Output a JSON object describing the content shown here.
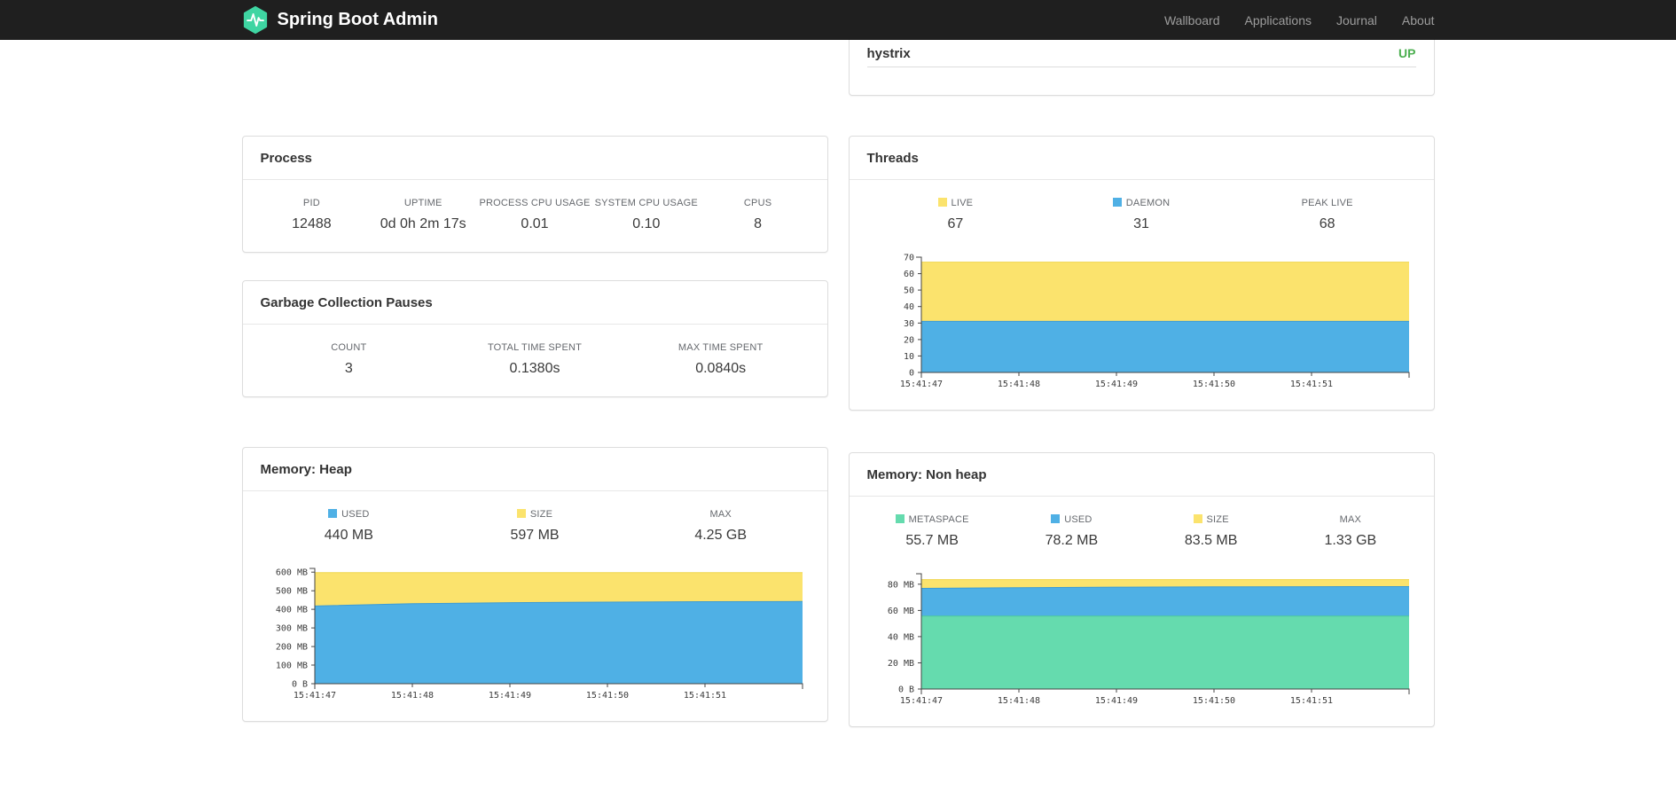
{
  "navbar": {
    "brand": "Spring Boot Admin",
    "links": [
      {
        "label": "Wallboard"
      },
      {
        "label": "Applications"
      },
      {
        "label": "Journal"
      },
      {
        "label": "About"
      }
    ]
  },
  "colors": {
    "brand_green": "#3FD5A2",
    "status_up": "#4CAF50",
    "series_yellow": "#FBE36D",
    "series_blue": "#4FB0E5",
    "series_green": "#65DBAE"
  },
  "health_card": {
    "rows": [
      {
        "name": "hystrix",
        "status": "UP"
      }
    ]
  },
  "process_card": {
    "title": "Process",
    "metrics": [
      {
        "label": "PID",
        "value": "12488"
      },
      {
        "label": "UPTIME",
        "value": "0d 0h 2m 17s"
      },
      {
        "label": "PROCESS CPU USAGE",
        "value": "0.01"
      },
      {
        "label": "SYSTEM CPU USAGE",
        "value": "0.10"
      },
      {
        "label": "CPUS",
        "value": "8"
      }
    ]
  },
  "gc_card": {
    "title": "Garbage Collection Pauses",
    "metrics": [
      {
        "label": "COUNT",
        "value": "3"
      },
      {
        "label": "TOTAL TIME SPENT",
        "value": "0.1380s"
      },
      {
        "label": "MAX TIME SPENT",
        "value": "0.0840s"
      }
    ]
  },
  "threads_card": {
    "title": "Threads",
    "metrics": [
      {
        "label": "LIVE",
        "value": "67",
        "color": "#FBE36D"
      },
      {
        "label": "DAEMON",
        "value": "31",
        "color": "#4FB0E5"
      },
      {
        "label": "PEAK LIVE",
        "value": "68"
      }
    ]
  },
  "heap_card": {
    "title": "Memory: Heap",
    "metrics": [
      {
        "label": "USED",
        "value": "440 MB",
        "color": "#4FB0E5"
      },
      {
        "label": "SIZE",
        "value": "597 MB",
        "color": "#FBE36D"
      },
      {
        "label": "MAX",
        "value": "4.25 GB"
      }
    ]
  },
  "nonheap_card": {
    "title": "Memory: Non heap",
    "metrics": [
      {
        "label": "METASPACE",
        "value": "55.7 MB",
        "color": "#65DBAE"
      },
      {
        "label": "USED",
        "value": "78.2 MB",
        "color": "#4FB0E5"
      },
      {
        "label": "SIZE",
        "value": "83.5 MB",
        "color": "#FBE36D"
      },
      {
        "label": "MAX",
        "value": "1.33 GB"
      }
    ]
  },
  "chart_data": [
    {
      "id": "threads",
      "type": "area",
      "title": "Threads",
      "xlabel": "",
      "ylabel": "",
      "grid": false,
      "legend_position": "top",
      "x": [
        "15:41:47",
        "15:41:48",
        "15:41:49",
        "15:41:50",
        "15:41:51"
      ],
      "ylim": [
        0,
        70
      ],
      "yticks": [
        {
          "v": 70,
          "label": "70"
        },
        {
          "v": 60,
          "label": "60"
        },
        {
          "v": 50,
          "label": "50"
        },
        {
          "v": 40,
          "label": "40"
        },
        {
          "v": 30,
          "label": "30"
        },
        {
          "v": 20,
          "label": "20"
        },
        {
          "v": 10,
          "label": "10"
        },
        {
          "v": 0,
          "label": "0"
        }
      ],
      "series": [
        {
          "name": "LIVE",
          "color": "#FBE36D",
          "line": "#EFD54E",
          "values": [
            67,
            67,
            67,
            67,
            67,
            67
          ]
        },
        {
          "name": "DAEMON",
          "color": "#4FB0E5",
          "line": "#3D9BD4",
          "values": [
            31,
            31,
            31,
            31,
            31,
            31
          ]
        }
      ]
    },
    {
      "id": "memory-heap",
      "type": "area",
      "title": "Memory: Heap",
      "xlabel": "",
      "ylabel": "",
      "grid": false,
      "legend_position": "top",
      "x": [
        "15:41:47",
        "15:41:48",
        "15:41:49",
        "15:41:50",
        "15:41:51"
      ],
      "ylim": [
        0,
        620
      ],
      "yticks": [
        {
          "v": 600,
          "label": "600 MB"
        },
        {
          "v": 500,
          "label": "500 MB"
        },
        {
          "v": 400,
          "label": "400 MB"
        },
        {
          "v": 300,
          "label": "300 MB"
        },
        {
          "v": 200,
          "label": "200 MB"
        },
        {
          "v": 100,
          "label": "100 MB"
        },
        {
          "v": 0,
          "label": "0 B"
        }
      ],
      "series": [
        {
          "name": "SIZE",
          "color": "#FBE36D",
          "line": "#EFD54E",
          "values": [
            597,
            597,
            597,
            597,
            597,
            597
          ]
        },
        {
          "name": "USED",
          "color": "#4FB0E5",
          "line": "#3D9BD4",
          "values": [
            418,
            430,
            436,
            439,
            441,
            442
          ]
        }
      ]
    },
    {
      "id": "memory-nonheap",
      "type": "area",
      "title": "Memory: Non heap",
      "xlabel": "",
      "ylabel": "",
      "grid": false,
      "legend_position": "top",
      "x": [
        "15:41:47",
        "15:41:48",
        "15:41:49",
        "15:41:50",
        "15:41:51"
      ],
      "ylim": [
        0,
        88
      ],
      "yticks": [
        {
          "v": 80,
          "label": "80 MB"
        },
        {
          "v": 60,
          "label": "60 MB"
        },
        {
          "v": 40,
          "label": "40 MB"
        },
        {
          "v": 20,
          "label": "20 MB"
        },
        {
          "v": 0,
          "label": "0 B"
        }
      ],
      "series": [
        {
          "name": "SIZE",
          "color": "#FBE36D",
          "line": "#EFD54E",
          "values": [
            83.5,
            83.5,
            83.5,
            83.5,
            83.5,
            83.5
          ]
        },
        {
          "name": "USED",
          "color": "#4FB0E5",
          "line": "#3D9BD4",
          "values": [
            76.8,
            77.4,
            77.8,
            78.0,
            78.1,
            78.2
          ]
        },
        {
          "name": "METASPACE",
          "color": "#65DBAE",
          "line": "#4FCB9B",
          "values": [
            55.7,
            55.7,
            55.7,
            55.7,
            55.7,
            55.7
          ]
        }
      ]
    }
  ]
}
